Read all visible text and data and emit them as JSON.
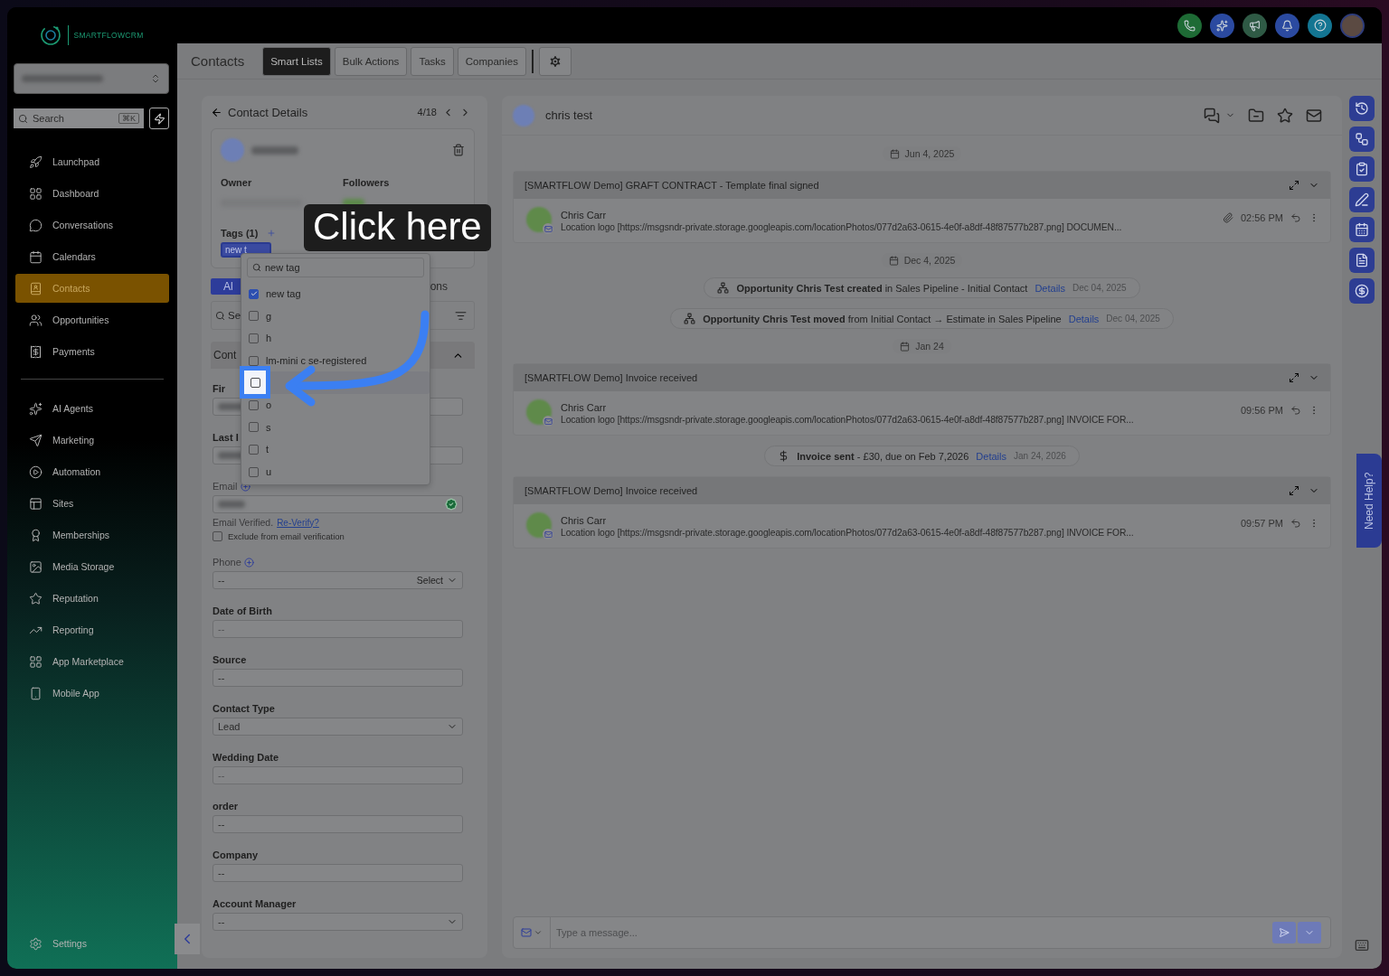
{
  "brand": {
    "name": "SMARTFLOWCRM"
  },
  "sidebar": {
    "search": {
      "placeholder": "Search",
      "shortcut": "⌘K"
    },
    "primary": [
      {
        "label": "Launchpad",
        "selected": false
      },
      {
        "label": "Dashboard",
        "selected": false
      },
      {
        "label": "Conversations",
        "selected": false
      },
      {
        "label": "Calendars",
        "selected": false
      },
      {
        "label": "Contacts",
        "selected": true
      },
      {
        "label": "Opportunities",
        "selected": false
      },
      {
        "label": "Payments",
        "selected": false
      }
    ],
    "secondary": [
      {
        "label": "AI Agents",
        "selected": false
      },
      {
        "label": "Marketing",
        "selected": false
      },
      {
        "label": "Automation",
        "selected": false
      },
      {
        "label": "Sites",
        "selected": false
      },
      {
        "label": "Memberships",
        "selected": false
      },
      {
        "label": "Media Storage",
        "selected": false
      },
      {
        "label": "Reputation",
        "selected": false
      },
      {
        "label": "Reporting",
        "selected": false
      },
      {
        "label": "App Marketplace",
        "selected": false
      },
      {
        "label": "Mobile App",
        "selected": false
      }
    ],
    "settings": "Settings"
  },
  "header": {
    "title": "Contacts",
    "tabs": [
      {
        "label": "Smart Lists",
        "selected": true
      },
      {
        "label": "Bulk Actions",
        "selected": false
      },
      {
        "label": "Tasks",
        "selected": false
      },
      {
        "label": "Companies",
        "selected": false
      }
    ]
  },
  "contact": {
    "title": "Contact Details",
    "pager": "4/18",
    "owner_label": "Owner",
    "followers_label": "Followers",
    "tags_label": "Tags (1)",
    "tags": [
      "new t"
    ],
    "tabs": [
      {
        "label": "Al",
        "selected": true
      },
      {
        "label": "ons",
        "selected": false
      }
    ],
    "search_placeholder": "Se",
    "section": {
      "title": "Cont",
      "expanded": true
    },
    "fields": [
      {
        "kind": "text",
        "label": "Fir",
        "blurred": true
      },
      {
        "kind": "text",
        "label": "Last I",
        "blurred": true
      },
      {
        "kind": "email",
        "label": "Email",
        "blurred": true,
        "verified": true,
        "note": "Email Verified.",
        "link": "Re-Verify?",
        "exclude": {
          "label": "Exclude from email verification",
          "checked": false
        }
      },
      {
        "kind": "phone",
        "label": "Phone",
        "value": "--",
        "select": "Select"
      },
      {
        "kind": "text",
        "label": "Date of Birth",
        "placeholder": "--"
      },
      {
        "kind": "text",
        "label": "Source",
        "value": "--"
      },
      {
        "kind": "select",
        "label": "Contact Type",
        "value": "Lead"
      },
      {
        "kind": "text",
        "label": "Wedding Date",
        "placeholder": "--"
      },
      {
        "kind": "text",
        "label": "order",
        "value": "--"
      },
      {
        "kind": "text",
        "label": "Company",
        "value": "--"
      },
      {
        "kind": "select",
        "label": "Account Manager",
        "value": "--"
      }
    ]
  },
  "tag_dropdown": {
    "search_value": "new tag",
    "options": [
      {
        "label": "new tag",
        "checked": true,
        "highlighted": false
      },
      {
        "label": "g",
        "checked": false,
        "highlighted": false
      },
      {
        "label": "h",
        "checked": false,
        "highlighted": false
      },
      {
        "label": "lm-mini c se-registered",
        "checked": false,
        "highlighted": false
      },
      {
        "checked": false,
        "highlighted": true
      },
      {
        "label": "o",
        "checked": false,
        "highlighted": false
      },
      {
        "label": "s",
        "checked": false,
        "highlighted": false
      },
      {
        "label": "t",
        "checked": false,
        "highlighted": false
      },
      {
        "label": "u",
        "checked": false,
        "highlighted": false
      }
    ]
  },
  "conversation": {
    "contact_name": "chris test",
    "feed": [
      {
        "kind": "date",
        "text": "Jun 4, 2025"
      },
      {
        "kind": "email",
        "subject": "[SMARTFLOW Demo] GRAFT CONTRACT - Template final signed",
        "sender": "Chris Carr",
        "preview": "Location logo [https://msgsndr-private.storage.googleapis.com/locationPhotos/077d2a63-0615-4e0f-a8df-48f87577b287.png] DOCUMEN...",
        "time": "02:56 PM",
        "attachment": true
      },
      {
        "kind": "date",
        "text": "Dec 4, 2025"
      },
      {
        "kind": "opportunity",
        "text": "**Opportunity Chris Test created** in Sales Pipeline - Initial Contact",
        "link": "Details",
        "date": "Dec 04, 2025"
      },
      {
        "kind": "opportunity",
        "text": "**Opportunity Chris Test moved** from Initial Contact → Estimate in Sales Pipeline",
        "link": "Details",
        "date": "Dec 04, 2025"
      },
      {
        "kind": "date",
        "text": "Jan 24"
      },
      {
        "kind": "email",
        "subject": "[SMARTFLOW Demo] Invoice received",
        "sender": "Chris Carr",
        "preview": "Location logo [https://msgsndr-private.storage.googleapis.com/locationPhotos/077d2a63-0615-4e0f-a8df-48f87577b287.png] INVOICE FOR...",
        "time": "09:56 PM",
        "attachment": false
      },
      {
        "kind": "invoice",
        "text": "**Invoice sent** - £30, due on Feb 7,2026",
        "link": "Details",
        "date": "Jan 24, 2026"
      },
      {
        "kind": "email",
        "subject": "[SMARTFLOW Demo] Invoice received",
        "sender": "Chris Carr",
        "preview": "Location logo [https://msgsndr-private.storage.googleapis.com/locationPhotos/077d2a63-0615-4e0f-a8df-48f87577b287.png] INVOICE FOR...",
        "time": "09:57 PM",
        "attachment": false
      }
    ],
    "composer": {
      "placeholder": "Type a message..."
    }
  },
  "callout": {
    "text": "Click here"
  },
  "help_tab": "Need Help?"
}
